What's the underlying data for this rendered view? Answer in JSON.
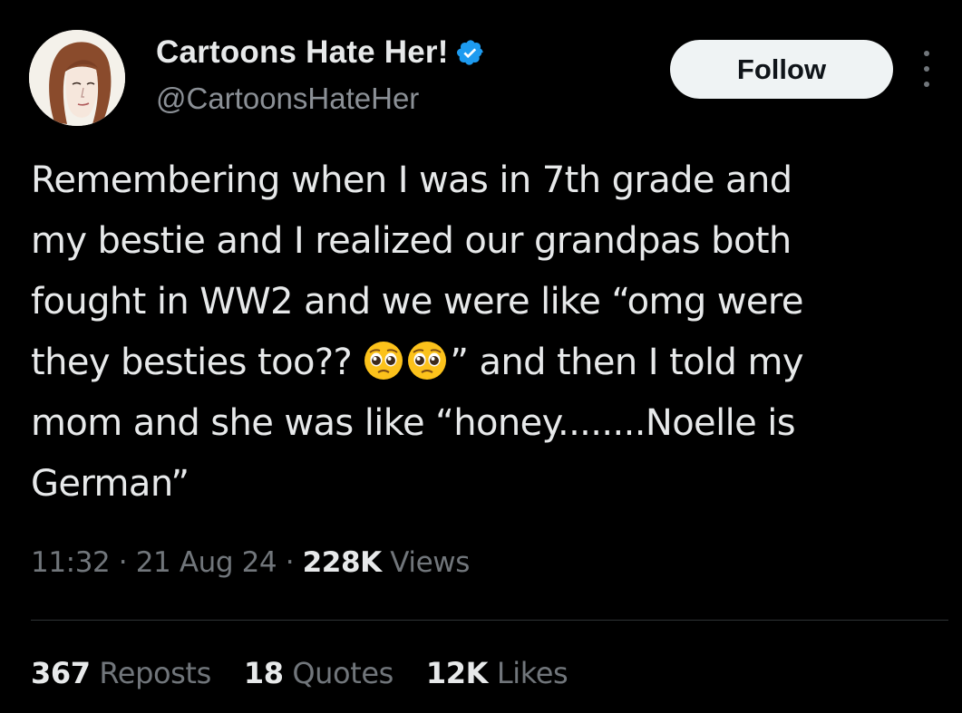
{
  "user": {
    "display_name": "Cartoons Hate Her!",
    "handle": "@CartoonsHateHer",
    "verified": true,
    "verified_icon": "verified-badge-icon",
    "verified_color": "#1d9bf0"
  },
  "actions": {
    "follow_label": "Follow",
    "more_icon": "more-options-icon"
  },
  "tweet": {
    "lines": [
      "Remembering when I was in 7th grade and",
      "my bestie and I realized our grandpas both",
      "fought in WW2 and we were like “omg were",
      "they besties too?? ",
      "” and then I told my",
      "mom and she was like “honey........Noelle is",
      "German”"
    ],
    "emoji": [
      "pleading-face-emoji",
      "pleading-face-emoji"
    ]
  },
  "meta": {
    "time": "11:32",
    "sep1": " · ",
    "date": "21 Aug 24",
    "sep2": " · ",
    "views_count": "228K",
    "views_label": " Views"
  },
  "stats": {
    "reposts_count": "367",
    "reposts_label": " Reposts",
    "quotes_count": "18",
    "quotes_label": " Quotes",
    "likes_count": "12K",
    "likes_label": " Likes"
  },
  "colors": {
    "background": "#000000",
    "text_primary": "#e7e9ea",
    "text_secondary": "#71767b",
    "follow_bg": "#eff3f4",
    "divider": "#2f3336"
  }
}
